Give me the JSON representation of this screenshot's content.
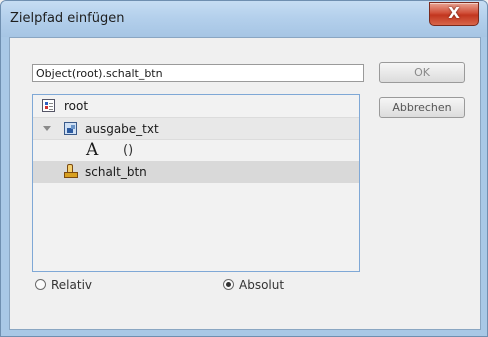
{
  "window": {
    "title": "Zielpfad einfügen",
    "close_glyph": "X"
  },
  "path_field": {
    "value": "Object(root).schalt_btn"
  },
  "buttons": {
    "ok": "OK",
    "cancel": "Abbrechen"
  },
  "tree": [
    {
      "label": "root",
      "icon": "movie-root-icon"
    },
    {
      "label": "ausgabe_txt",
      "icon": "movieclip-icon",
      "expanded": true
    },
    {
      "glyph": "A",
      "label": "()",
      "icon": "text-icon"
    },
    {
      "label": "schalt_btn",
      "icon": "button-hand-icon",
      "selected": true
    }
  ],
  "mode": {
    "options": [
      "Relativ",
      "Absolut"
    ],
    "selected": "Absolut"
  }
}
